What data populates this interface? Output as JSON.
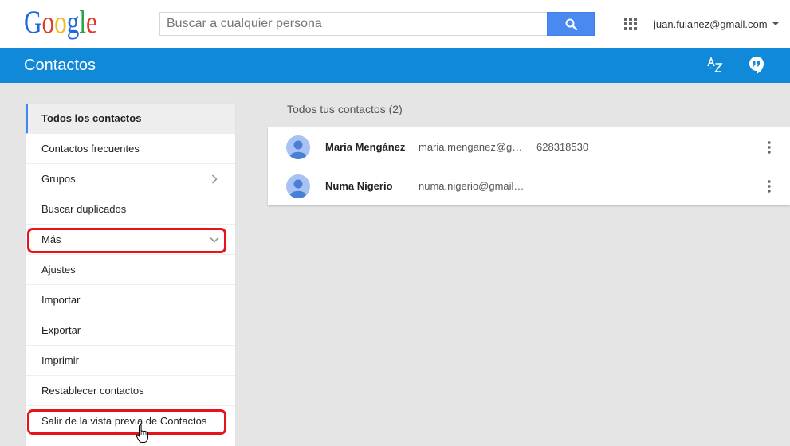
{
  "header": {
    "logo": {
      "text": "Google",
      "colors": [
        "#1f64e0",
        "#e2382b",
        "#f4b818",
        "#1f64e0",
        "#2ba24c",
        "#e2382b"
      ]
    },
    "search": {
      "placeholder": "Buscar a cualquier persona",
      "button_icon": "search-icon",
      "button_color": "#4a89f0"
    },
    "apps_icon": "apps-grid-icon",
    "account": {
      "email": "juan.fulanez@gmail.com",
      "dropdown_icon": "caret-down-icon"
    }
  },
  "appbar": {
    "title": "Contactos",
    "color": "#0f89d8",
    "actions": [
      {
        "icon": "sort-az-icon"
      },
      {
        "icon": "hangouts-icon"
      }
    ]
  },
  "sidebar": {
    "accent_color": "#4285f4",
    "items": [
      {
        "label": "Todos los contactos",
        "active": true
      },
      {
        "label": "Contactos frecuentes"
      },
      {
        "label": "Grupos",
        "chevron_icon": "chevron-right-icon"
      },
      {
        "label": "Buscar duplicados"
      },
      {
        "label": "Más",
        "chevron_icon": "chevron-down-icon",
        "highlighted": true
      },
      {
        "label": "Ajustes"
      },
      {
        "label": "Importar"
      },
      {
        "label": "Exportar"
      },
      {
        "label": "Imprimir"
      },
      {
        "label": "Restablecer contactos"
      },
      {
        "label": "Salir de la vista previa de Contactos",
        "highlighted": true
      }
    ]
  },
  "main": {
    "heading": "Todos tus contactos (2)",
    "contacts": [
      {
        "name": "Maria Mengánez",
        "email": "maria.menganez@g…",
        "phone": "628318530",
        "avatar_icon": "person-avatar-icon",
        "menu_icon": "more-vert-icon"
      },
      {
        "name": "Numa Nigerio",
        "email": "numa.nigerio@gmail…",
        "avatar_icon": "person-avatar-icon",
        "menu_icon": "more-vert-icon"
      }
    ]
  },
  "annotations": {
    "highlight_color": "#e8141c",
    "cursor_icon": "hand-pointer-cursor-icon"
  }
}
